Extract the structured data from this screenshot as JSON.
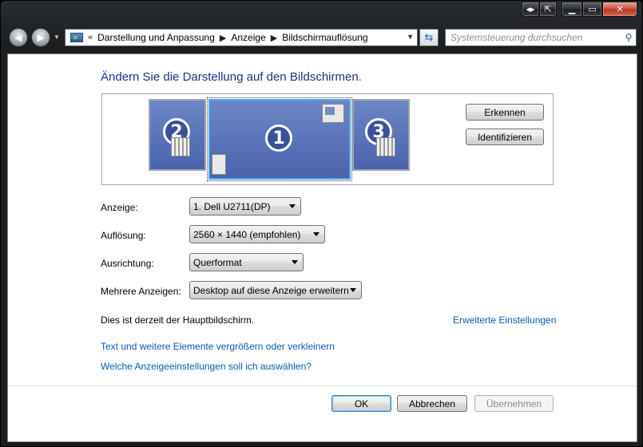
{
  "window": {
    "caption_buttons": [
      "arrows-icon",
      "pin-icon",
      "minimize-icon",
      "maximize-icon",
      "close-icon"
    ]
  },
  "navigation": {
    "breadcrumb": [
      "Darstellung und Anpassung",
      "Anzeige",
      "Bildschirmauflösung"
    ],
    "breadcrumb_prefix": "«",
    "search_placeholder": "Systemsteuerung durchsuchen"
  },
  "main": {
    "heading": "Ändern Sie die Darstellung auf den Bildschirmen.",
    "monitors": [
      {
        "number": "2",
        "selected": false
      },
      {
        "number": "1",
        "selected": true
      },
      {
        "number": "3",
        "selected": false
      }
    ],
    "detect_button": "Erkennen",
    "identify_button": "Identifizieren",
    "fields": {
      "display_label": "Anzeige:",
      "display_value": "1. Dell U2711(DP)",
      "resolution_label": "Auflösung:",
      "resolution_value": "2560 × 1440 (empfohlen)",
      "orientation_label": "Ausrichtung:",
      "orientation_value": "Querformat",
      "multiple_label": "Mehrere Anzeigen:",
      "multiple_value": "Desktop auf diese Anzeige erweitern"
    },
    "status_text": "Dies ist derzeit der Hauptbildschirm.",
    "advanced_link": "Erweiterte Einstellungen",
    "links": {
      "text_size": "Text und weitere Elemente vergrößern oder verkleinern",
      "which_settings": "Welche Anzeigeeinstellungen soll ich auswählen?"
    }
  },
  "footer": {
    "ok": "OK",
    "cancel": "Abbrechen",
    "apply": "Übernehmen"
  }
}
